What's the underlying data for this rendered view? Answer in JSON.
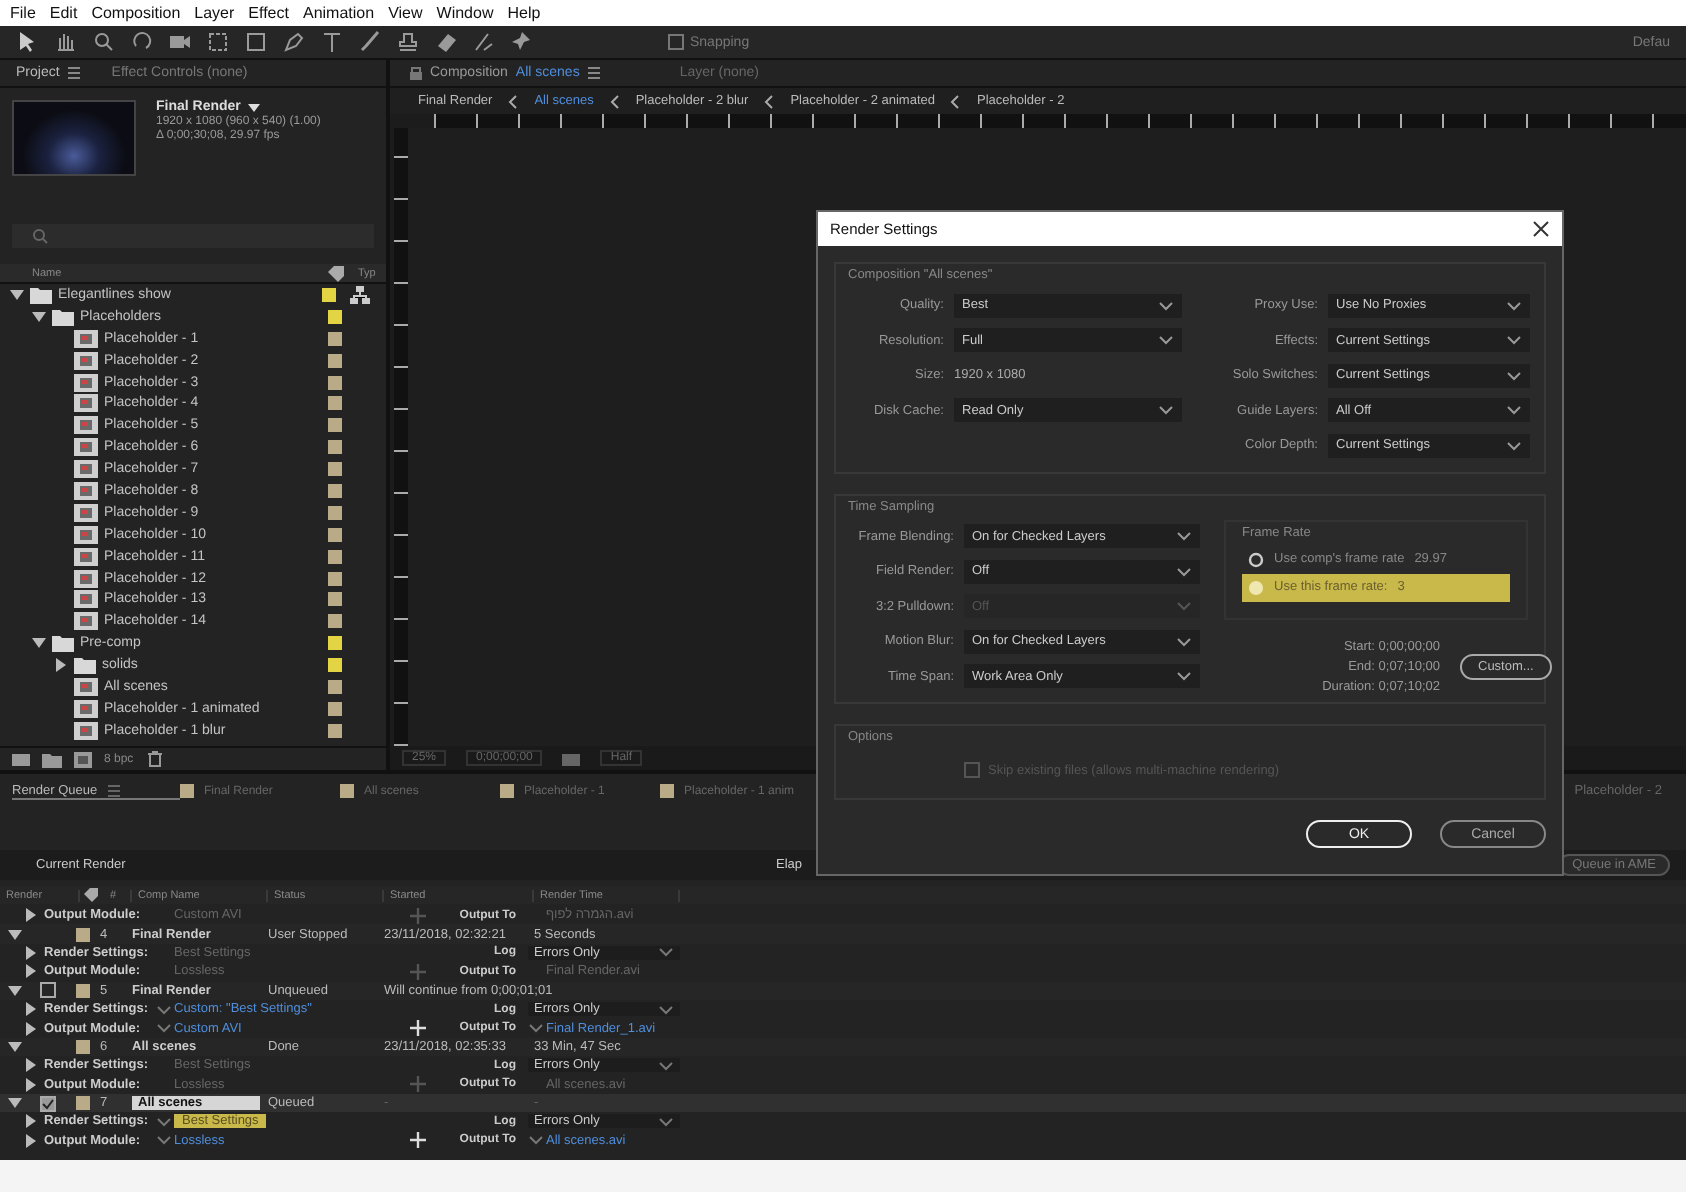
{
  "menu": [
    "File",
    "Edit",
    "Composition",
    "Layer",
    "Effect",
    "Animation",
    "View",
    "Window",
    "Help"
  ],
  "toolbar": {
    "snapping": "Snapping",
    "workspace": "Defau"
  },
  "project": {
    "tabs": [
      {
        "label": "Project",
        "selected": true
      },
      {
        "label": "Effect Controls (none)",
        "selected": false
      }
    ],
    "selection": {
      "name": "Final Render",
      "size": "1920 x 1080 (960 x 540) (1.00)",
      "duration": "Δ 0;00;30;08, 29.97 fps"
    },
    "columns": [
      "Name",
      "Typ"
    ],
    "tree": [
      {
        "name": "Elegantlines show",
        "kind": "folder",
        "expanded": true,
        "color": "#e3d443",
        "children": [
          {
            "name": "Placeholders",
            "kind": "folder",
            "expanded": true,
            "color": "#e3d443",
            "children": [
              {
                "name": "Placeholder - 1",
                "kind": "comp",
                "color": "#b9aa88"
              },
              {
                "name": "Placeholder - 2",
                "kind": "comp",
                "color": "#b9aa88"
              },
              {
                "name": "Placeholder - 3",
                "kind": "comp",
                "color": "#b9aa88"
              },
              {
                "name": "Placeholder - 4",
                "kind": "comp",
                "color": "#b9aa88"
              },
              {
                "name": "Placeholder - 5",
                "kind": "comp",
                "color": "#b9aa88"
              },
              {
                "name": "Placeholder - 6",
                "kind": "comp",
                "color": "#b9aa88"
              },
              {
                "name": "Placeholder - 7",
                "kind": "comp",
                "color": "#b9aa88"
              },
              {
                "name": "Placeholder - 8",
                "kind": "comp",
                "color": "#b9aa88"
              },
              {
                "name": "Placeholder - 9",
                "kind": "comp",
                "color": "#b9aa88"
              },
              {
                "name": "Placeholder - 10",
                "kind": "comp",
                "color": "#b9aa88"
              },
              {
                "name": "Placeholder - 11",
                "kind": "comp",
                "color": "#b9aa88"
              },
              {
                "name": "Placeholder - 12",
                "kind": "comp",
                "color": "#b9aa88"
              },
              {
                "name": "Placeholder - 13",
                "kind": "comp",
                "color": "#b9aa88"
              },
              {
                "name": "Placeholder - 14",
                "kind": "comp",
                "color": "#b9aa88"
              }
            ]
          },
          {
            "name": "Pre-comp",
            "kind": "folder",
            "expanded": true,
            "color": "#e3d443",
            "children": [
              {
                "name": "solids",
                "kind": "folder",
                "expanded": false,
                "color": "#e3d443"
              },
              {
                "name": "All scenes",
                "kind": "comp",
                "color": "#b9aa88"
              },
              {
                "name": "Placeholder - 1 animated",
                "kind": "comp",
                "color": "#b9aa88"
              },
              {
                "name": "Placeholder - 1 blur",
                "kind": "comp",
                "color": "#b9aa88"
              }
            ]
          }
        ]
      }
    ],
    "depth": "8 bpc"
  },
  "viewer": {
    "tabs": [
      {
        "label": "Composition",
        "name": "All scenes",
        "selected": true
      },
      {
        "label": "Layer (none)",
        "selected": false
      }
    ],
    "breadcrumbs": [
      {
        "label": "Final Render",
        "selected": false
      },
      {
        "label": "All scenes",
        "selected": true
      },
      {
        "label": "Placeholder - 2 blur",
        "selected": false
      },
      {
        "label": "Placeholder - 2 animated",
        "selected": false
      },
      {
        "label": "Placeholder - 2",
        "selected": false
      }
    ],
    "zoom": "25%",
    "timecode": "0;00;00;00",
    "resolution": "Half"
  },
  "render_settings": {
    "title": "Render Settings",
    "composition": {
      "title": "Composition \"All scenes\"",
      "left": [
        {
          "label": "Quality:",
          "value": "Best",
          "kind": "dropdown"
        },
        {
          "label": "Resolution:",
          "value": "Full",
          "kind": "dropdown"
        },
        {
          "label": "Size:",
          "value": "1920 x 1080",
          "kind": "text"
        },
        {
          "label": "Disk Cache:",
          "value": "Read Only",
          "kind": "dropdown"
        }
      ],
      "right": [
        {
          "label": "Proxy Use:",
          "value": "Use No Proxies",
          "kind": "dropdown"
        },
        {
          "label": "Effects:",
          "value": "Current Settings",
          "kind": "dropdown"
        },
        {
          "label": "Solo Switches:",
          "value": "Current Settings",
          "kind": "dropdown"
        },
        {
          "label": "Guide Layers:",
          "value": "All Off",
          "kind": "dropdown"
        },
        {
          "label": "Color Depth:",
          "value": "Current Settings",
          "kind": "dropdown"
        }
      ]
    },
    "time_sampling": {
      "title": "Time Sampling",
      "fields": [
        {
          "label": "Frame Blending:",
          "value": "On for Checked Layers",
          "disabled": false
        },
        {
          "label": "Field Render:",
          "value": "Off",
          "disabled": false
        },
        {
          "label": "3:2 Pulldown:",
          "value": "Off",
          "disabled": true
        },
        {
          "label": "Motion Blur:",
          "value": "On for Checked Layers",
          "disabled": false
        },
        {
          "label": "Time Span:",
          "value": "Work Area Only",
          "disabled": false
        }
      ],
      "frame_rate": {
        "title": "Frame Rate",
        "options": [
          {
            "label": "Use comp's frame rate",
            "value": "29.97",
            "selected": false
          },
          {
            "label": "Use this frame rate:",
            "value": "3",
            "selected": true
          }
        ]
      },
      "timing": [
        {
          "label": "Start:",
          "value": "0;00;00;00"
        },
        {
          "label": "End:",
          "value": "0;07;10;00"
        },
        {
          "label": "Duration:",
          "value": "0;07;10;02"
        }
      ],
      "custom_button": "Custom..."
    },
    "options": {
      "title": "Options",
      "skip_existing": {
        "label": "Skip existing files (allows multi-machine rendering)",
        "checked": false,
        "disabled": true
      }
    },
    "buttons": [
      {
        "label": "OK",
        "default": true
      },
      {
        "label": "Cancel",
        "default": false
      }
    ]
  },
  "render_queue": {
    "tabs": [
      {
        "label": "Render Queue",
        "kind": "queue",
        "selected": true
      },
      {
        "label": "Final Render",
        "kind": "comp",
        "selected": false,
        "color": "#b9aa88"
      },
      {
        "label": "All scenes",
        "kind": "comp",
        "selected": false,
        "color": "#b9aa88"
      },
      {
        "label": "Placeholder - 1",
        "kind": "comp",
        "selected": false,
        "color": "#b9aa88"
      },
      {
        "label": "Placeholder - 1 anim",
        "kind": "comp",
        "selected": false,
        "color": "#b9aa88"
      },
      {
        "label": "Placeholder - 2",
        "kind": "far",
        "selected": false
      }
    ],
    "current_render": "Current Render",
    "elapsed": "Elap",
    "ame_button": "Queue in AME",
    "columns": [
      "Render",
      "#",
      "Comp Name",
      "Status",
      "Started",
      "Render Time"
    ],
    "cut_row": {
      "label": "Output Module:",
      "value": "Custom AVI",
      "output_label": "Output To",
      "output": "הגמרה לפוף.avi"
    },
    "items": [
      {
        "number": "4",
        "comp": "Final Render",
        "status": "User Stopped",
        "started": "23/11/2018, 02:32:21",
        "render_time": "5 Seconds",
        "kind": "finished",
        "expanded": true,
        "selected": false,
        "color": "#b9aa88",
        "settings": {
          "label": "Render Settings:",
          "value": "Best Settings",
          "editable": false,
          "highlighted": false
        },
        "log": {
          "label": "Log",
          "value": "Errors Only"
        },
        "module": {
          "label": "Output Module:",
          "value": "Lossless",
          "editable": false
        },
        "output": {
          "label": "Output To",
          "value": "Final Render.avi",
          "editable": false
        }
      },
      {
        "number": "5",
        "comp": "Final Render",
        "status": "Unqueued",
        "started": "Will continue from 0;00;01;01",
        "kind": "pending",
        "checked": false,
        "expanded": true,
        "selected": false,
        "color": "#b9aa88",
        "settings": {
          "label": "Render Settings:",
          "value": "Custom: \"Best Settings\"",
          "editable": true,
          "highlighted": false
        },
        "log": {
          "label": "Log",
          "value": "Errors Only"
        },
        "module": {
          "label": "Output Module:",
          "value": "Custom AVI",
          "editable": true
        },
        "output": {
          "label": "Output To",
          "value": "Final Render_1.avi",
          "editable": true
        }
      },
      {
        "number": "6",
        "comp": "All scenes",
        "status": "Done",
        "started": "23/11/2018, 02:35:33",
        "render_time": "33 Min, 47 Sec",
        "kind": "finished",
        "expanded": true,
        "selected": false,
        "color": "#b9aa88",
        "settings": {
          "label": "Render Settings:",
          "value": "Best Settings",
          "editable": false,
          "highlighted": false
        },
        "log": {
          "label": "Log",
          "value": "Errors Only"
        },
        "module": {
          "label": "Output Module:",
          "value": "Lossless",
          "editable": false
        },
        "output": {
          "label": "Output To",
          "value": "All scenes.avi",
          "editable": false
        }
      },
      {
        "number": "7",
        "comp": "All scenes",
        "status": "Queued",
        "started": "-",
        "render_time": "-",
        "kind": "pending",
        "checked": true,
        "expanded": true,
        "selected": true,
        "color": "#b9aa88",
        "settings": {
          "label": "Render Settings:",
          "value": "Best Settings",
          "editable": true,
          "highlighted": true
        },
        "log": {
          "label": "Log",
          "value": "Errors Only"
        },
        "module": {
          "label": "Output Module:",
          "value": "Lossless",
          "editable": true
        },
        "output": {
          "label": "Output To",
          "value": "All scenes.avi",
          "editable": true
        }
      }
    ]
  }
}
